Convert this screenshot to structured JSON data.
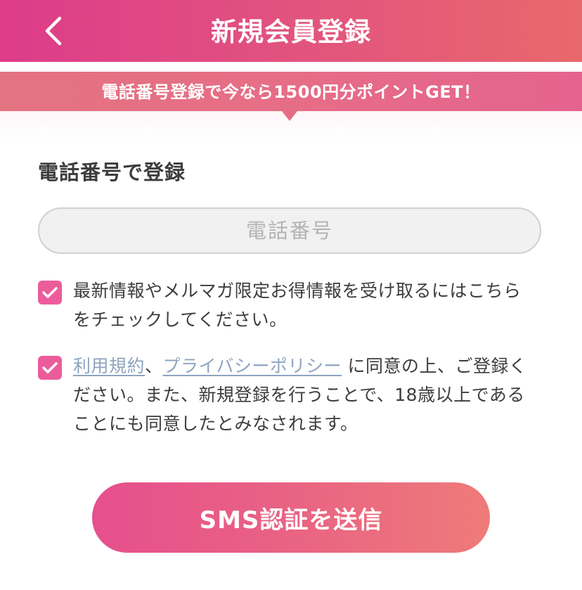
{
  "header": {
    "title": "新規会員登録",
    "back_icon": "chevron-left-icon",
    "gradient": [
      "#dd3c8a",
      "#e9686b"
    ]
  },
  "banner": {
    "text": "電話番号登録で今なら1500円分ポイントGET！",
    "color": "#e66d86"
  },
  "form": {
    "section_title": "電話番号で登録",
    "phone_placeholder": "電話番号",
    "phone_value": "",
    "newsletter": {
      "checked": true,
      "text": "最新情報やメルマガ限定お得情報を受け取るにはこちらをチェックしてください。"
    },
    "terms": {
      "checked": true,
      "link_terms": "利用規約",
      "separator": "、",
      "link_privacy": "プライバシーポリシー",
      "text_after": " に同意の上、ご登録ください。また、新規登録を行うことで、18歳以上であることにも同意したとみなされます。"
    },
    "submit_label": "SMS認証を送信",
    "checkbox_color": "#ec5c9b",
    "link_color": "#8ea4c0"
  }
}
